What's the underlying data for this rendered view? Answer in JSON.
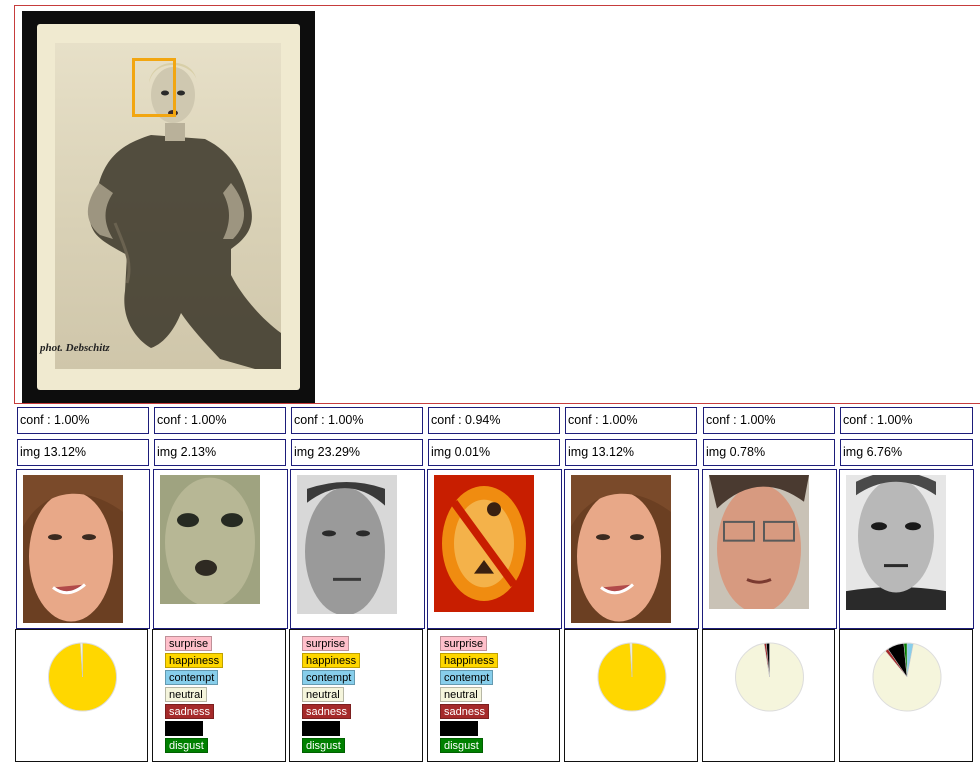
{
  "photo": {
    "caption": "phot. Debschitz"
  },
  "emotions": [
    {
      "key": "surprise",
      "label": "surprise",
      "color": "#ffc0cb",
      "text": "#000"
    },
    {
      "key": "happiness",
      "label": "happiness",
      "color": "#ffd700",
      "text": "#000"
    },
    {
      "key": "contempt",
      "label": "contempt",
      "color": "#87ceeb",
      "text": "#000"
    },
    {
      "key": "neutral",
      "label": "neutral",
      "color": "#f5f5dc",
      "text": "#000"
    },
    {
      "key": "sadness",
      "label": "sadness",
      "color": "#a52a2a",
      "text": "#fff"
    },
    {
      "key": "anger",
      "label": "",
      "color": "#000000",
      "text": "#fff"
    },
    {
      "key": "disgust",
      "label": "disgust",
      "color": "#008000",
      "text": "#fff"
    }
  ],
  "results": [
    {
      "conf": "conf : 1.00%",
      "img": "img 13.12%",
      "face": "woman-smiling-face",
      "show_legend": false,
      "scores": {
        "surprise": 0,
        "happiness": 0.99,
        "contempt": 0,
        "neutral": 0.01,
        "sadness": 0,
        "anger": 0,
        "disgust": 0
      }
    },
    {
      "conf": "conf : 1.00%",
      "img": "img 2.13%",
      "face": "vintage-woman-face",
      "show_legend": true,
      "scores": {}
    },
    {
      "conf": "conf : 1.00%",
      "img": "img 23.29%",
      "face": "bw-man-face",
      "show_legend": true,
      "scores": {}
    },
    {
      "conf": "conf : 0.94%",
      "img": "img 0.01%",
      "face": "no-face-symbol",
      "show_legend": true,
      "scores": {}
    },
    {
      "conf": "conf : 1.00%",
      "img": "img 13.12%",
      "face": "woman-smiling-face",
      "show_legend": false,
      "scores": {
        "surprise": 0,
        "happiness": 0.99,
        "contempt": 0,
        "neutral": 0.01,
        "sadness": 0,
        "anger": 0,
        "disgust": 0
      }
    },
    {
      "conf": "conf : 1.00%",
      "img": "img 0.78%",
      "face": "man-glasses-face",
      "show_legend": false,
      "scores": {
        "surprise": 0,
        "happiness": 0,
        "contempt": 0,
        "neutral": 0.975,
        "sadness": 0.01,
        "anger": 0.015,
        "disgust": 0
      }
    },
    {
      "conf": "conf : 1.00%",
      "img": "img 6.76%",
      "face": "engraved-man-face",
      "show_legend": false,
      "scores": {
        "surprise": 0,
        "happiness": 0,
        "contempt": 0.03,
        "neutral": 0.86,
        "sadness": 0.015,
        "anger": 0.08,
        "disgust": 0.015
      }
    }
  ]
}
